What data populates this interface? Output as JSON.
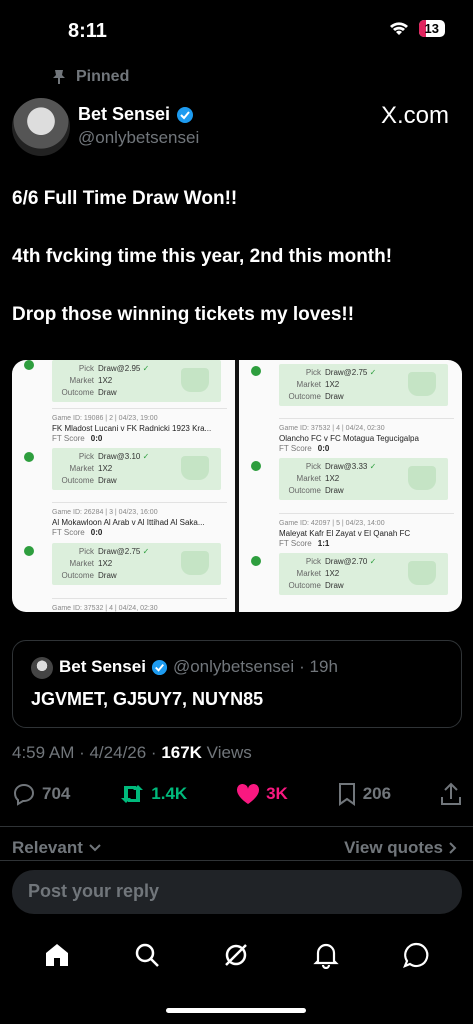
{
  "status_bar": {
    "time": "8:11",
    "battery": "13"
  },
  "pinned_label": "Pinned",
  "author": {
    "name": "Bet Sensei",
    "handle": "@onlybetsensei"
  },
  "brand": "X.com",
  "tweet": {
    "lines": [
      "6/6 Full Time Draw Won!!",
      "4th fvcking time this year, 2nd this month!",
      "Drop those winning tickets my loves!!"
    ]
  },
  "media": {
    "left": {
      "top_block": {
        "pick": "Draw@2.95",
        "market": "1X2",
        "outcome": "Draw"
      },
      "games": [
        {
          "info": "Game ID: 19086 | 2 | 04/23, 19:00",
          "teams": "FK Mladost Lucani v FK Radnicki 1923 Kra...",
          "score": "0:0",
          "pick": "Draw@3.10",
          "market": "1X2",
          "outcome": "Draw"
        },
        {
          "info": "Game ID: 26284 | 3 | 04/23, 16:00",
          "teams": "Al Mokawloon Al Arab v Al Ittihad Al Saka...",
          "score": "0:0",
          "pick": "Draw@2.75",
          "market": "1X2",
          "outcome": "Draw"
        }
      ],
      "footer_info": "Game ID: 37532 | 4 | 04/24, 02:30"
    },
    "right": {
      "top_block": {
        "pick": "Draw@2.75",
        "market": "1X2",
        "outcome": "Draw"
      },
      "games": [
        {
          "info": "Game ID: 37532 | 4 | 04/24, 02:30",
          "teams": "Olancho FC v FC Motagua Tegucigalpa",
          "score": "0:0",
          "pick": "Draw@3.33",
          "market": "1X2",
          "outcome": "Draw"
        },
        {
          "info": "Game ID: 42097 | 5 | 04/23, 14:00",
          "teams": "Maleyat Kafr El Zayat v El Qanah FC",
          "score": "1:1",
          "pick": "Draw@2.70",
          "market": "1X2",
          "outcome": "Draw"
        }
      ]
    },
    "labels": {
      "pick": "Pick",
      "market": "Market",
      "outcome": "Outcome",
      "ft_score": "FT Score"
    }
  },
  "quote": {
    "name": "Bet Sensei",
    "handle": "@onlybetsensei",
    "age": "· 19h",
    "text": "JGVMET, GJ5UY7, NUYN85"
  },
  "meta": {
    "time": "4:59 AM · 4/24/26 · ",
    "views_count": "167K",
    "views_label": " Views"
  },
  "actions": {
    "replies": "704",
    "reposts": "1.4K",
    "likes": "3K",
    "bookmarks": "206"
  },
  "colors": {
    "repost": "#00ba7c",
    "like": "#f91880",
    "verified": "#1d9bf0"
  },
  "sort": {
    "relevant": "Relevant",
    "view_quotes": "View quotes"
  },
  "reply_placeholder": "Post your reply"
}
